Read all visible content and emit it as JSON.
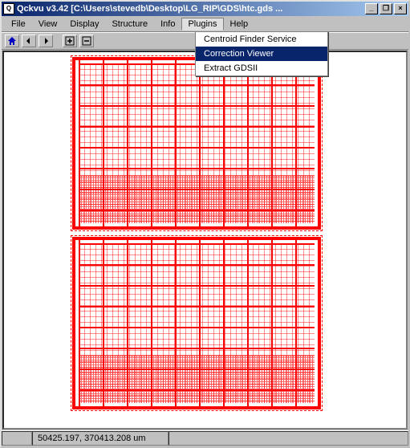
{
  "title": "Qckvu v3.42 [C:\\Users\\stevedb\\Desktop\\LG_RIP\\GDS\\htc.gds ...",
  "app_icon_text": "Q",
  "win_buttons": {
    "min": "_",
    "max": "❐",
    "close": "×"
  },
  "menubar": [
    "File",
    "View",
    "Display",
    "Structure",
    "Info",
    "Plugins",
    "Help"
  ],
  "open_menu_index": 5,
  "plugins_menu": {
    "items": [
      "Centroid Finder Service",
      "Correction Viewer",
      "Extract GDSII"
    ],
    "selected_index": 1
  },
  "toolbar": {
    "home": "home-icon",
    "back": "arrow-left-icon",
    "fwd": "arrow-right-icon",
    "zoom_in": "plus-box-icon",
    "zoom_out": "minus-box-icon"
  },
  "status": {
    "coords": "50425.197, 370413.208 um"
  }
}
